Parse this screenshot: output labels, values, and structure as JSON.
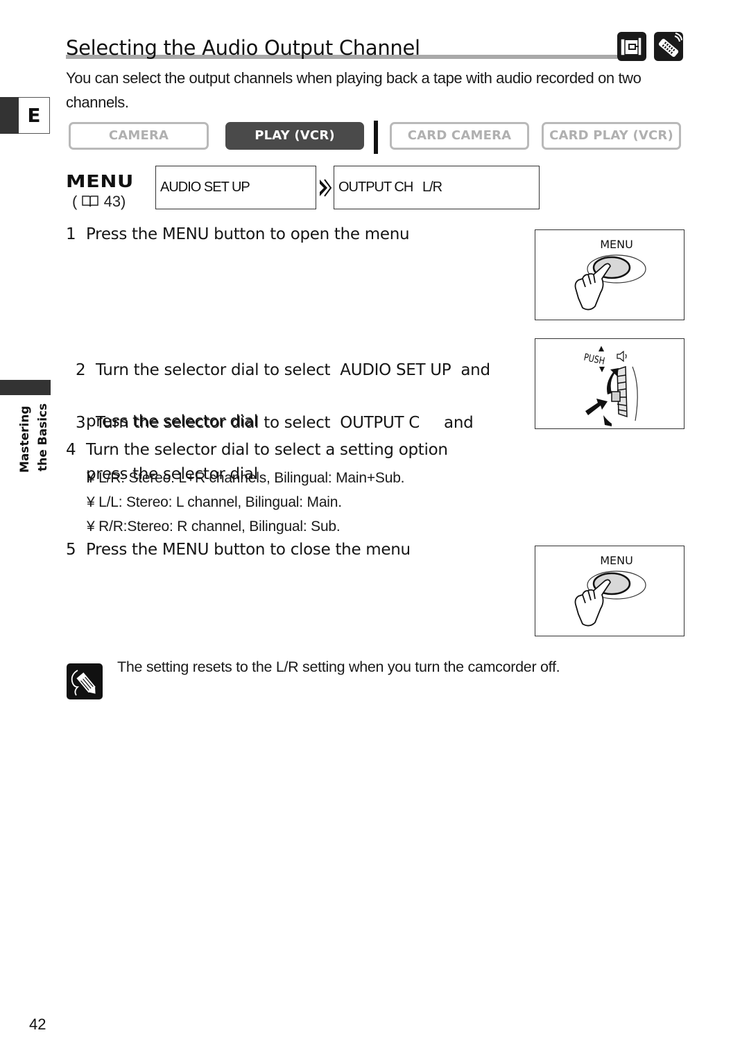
{
  "page": {
    "title": "Selecting the Audio Output Channel",
    "intro": "You can select the output channels when playing back a tape with audio recorded on two channels.",
    "language_tab": "E",
    "section_label": [
      "Mastering",
      "the Basics"
    ],
    "page_number": "42",
    "mode_icons": [
      "camcorder-icon",
      "remote-control-icon"
    ]
  },
  "modes": {
    "items": [
      {
        "label": "CAMERA",
        "active": false
      },
      {
        "label": "PLAY (VCR)",
        "active": true
      },
      {
        "label": "CARD CAMERA",
        "active": false
      },
      {
        "label": "CARD PLAY (VCR)",
        "active": false
      }
    ]
  },
  "menu_path": {
    "menu_label": "MENU",
    "ref_page": "43)",
    "ref_open": "(",
    "level1": "AUDIO SET UP",
    "level2": "OUTPUT CH   L/R"
  },
  "steps": [
    {
      "num": "1",
      "text": "Press the MENU button to open the menu"
    },
    {
      "num": "2",
      "line1": "Turn the selector dial to select  AUDIO SET UP  and",
      "line2": "press the selector dial"
    },
    {
      "num": "3",
      "line1": "Turn the selector dial to select  OUTPUT C     and",
      "line2": "press the selector dial"
    },
    {
      "num": "4",
      "text": "Turn the selector dial to select a setting option"
    },
    {
      "num": "5",
      "text": "Press the MENU button to close the menu"
    }
  ],
  "options": [
    "¥ L/R: Stereo: L+R channels, Bilingual: Main+Sub.",
    "¥ L/L: Stereo: L channel, Bilingual: Main.",
    "¥ R/R:Stereo: R channel, Bilingual: Sub."
  ],
  "illustrations": {
    "menu_button_label": "MENU",
    "dial_label": "PUSH"
  },
  "note": {
    "text": "The setting resets to the L/R setting when you turn the camcorder off."
  }
}
